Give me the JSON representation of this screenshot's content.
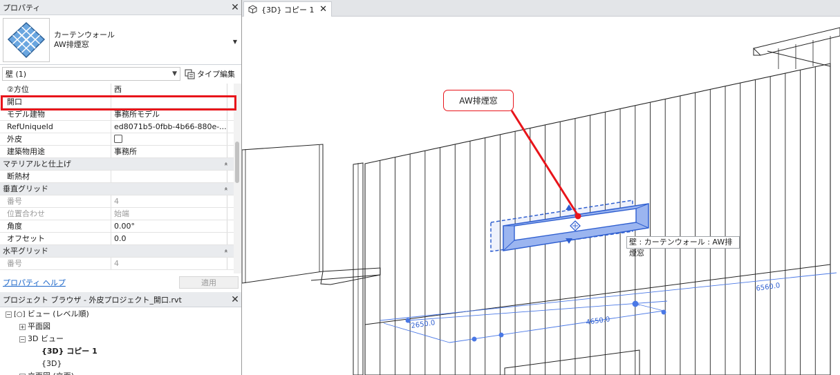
{
  "properties_panel": {
    "title": "プロパティ",
    "close_label": "✕",
    "type_family": "カーテンウォール",
    "type_name": "AW排煙窓",
    "instance_filter": "壁 (1)",
    "edit_type_label": "タイプ編集",
    "rows": [
      {
        "kind": "prop",
        "name": "②方位",
        "value": "西"
      },
      {
        "kind": "prop",
        "name": "開口",
        "value": ""
      },
      {
        "kind": "prop",
        "name": "モデル建物",
        "value": "事務所モデル"
      },
      {
        "kind": "prop",
        "name": "RefUniqueId",
        "value": "ed8071b5-0fbb-4b66-880e-..."
      },
      {
        "kind": "check",
        "name": "外皮",
        "value": ""
      },
      {
        "kind": "prop",
        "name": "建築物用途",
        "value": "事務所"
      },
      {
        "kind": "group",
        "name": "マテリアルと仕上げ",
        "value": "»"
      },
      {
        "kind": "prop",
        "name": "断熱材",
        "value": ""
      },
      {
        "kind": "group",
        "name": "垂直グリッド",
        "value": "»"
      },
      {
        "kind": "disabled",
        "name": "番号",
        "value": "4"
      },
      {
        "kind": "disabled",
        "name": "位置合わせ",
        "value": "始端"
      },
      {
        "kind": "prop",
        "name": "角度",
        "value": "0.00°"
      },
      {
        "kind": "prop",
        "name": "オフセット",
        "value": "0.0"
      },
      {
        "kind": "group",
        "name": "水平グリッド",
        "value": "»"
      },
      {
        "kind": "disabled",
        "name": "番号",
        "value": "4"
      }
    ],
    "help_link": "プロパティ ヘルプ",
    "apply_label": "適用"
  },
  "project_browser": {
    "title": "プロジェクト ブラウザ - 外皮プロジェクト_開口.rvt",
    "close_label": "✕",
    "nodes": [
      {
        "toggle": "−",
        "label": "ビュー (レベル順)",
        "indent": 0,
        "bold": false
      },
      {
        "toggle": "+",
        "label": "平面図",
        "indent": 1,
        "bold": false
      },
      {
        "toggle": "−",
        "label": "3D ビュー",
        "indent": 1,
        "bold": false
      },
      {
        "toggle": "",
        "label": "{3D} コピー 1",
        "indent": 2,
        "bold": true
      },
      {
        "toggle": "",
        "label": "{3D}",
        "indent": 2,
        "bold": false
      },
      {
        "toggle": "+",
        "label": "立面図 (立面)",
        "indent": 1,
        "bold": false
      }
    ]
  },
  "view": {
    "tab_label": "{3D} コピー 1",
    "tab_close": "✕",
    "callout_label": "AW排煙窓",
    "tooltip": "壁 : カーテンウォール : AW排煙窓",
    "dimensions": [
      "2650.0",
      "4650.0",
      "6560.0"
    ]
  },
  "colors": {
    "highlight": "#e8141a",
    "selection": "#2f5fd0",
    "dimension": "#4a78e6"
  }
}
